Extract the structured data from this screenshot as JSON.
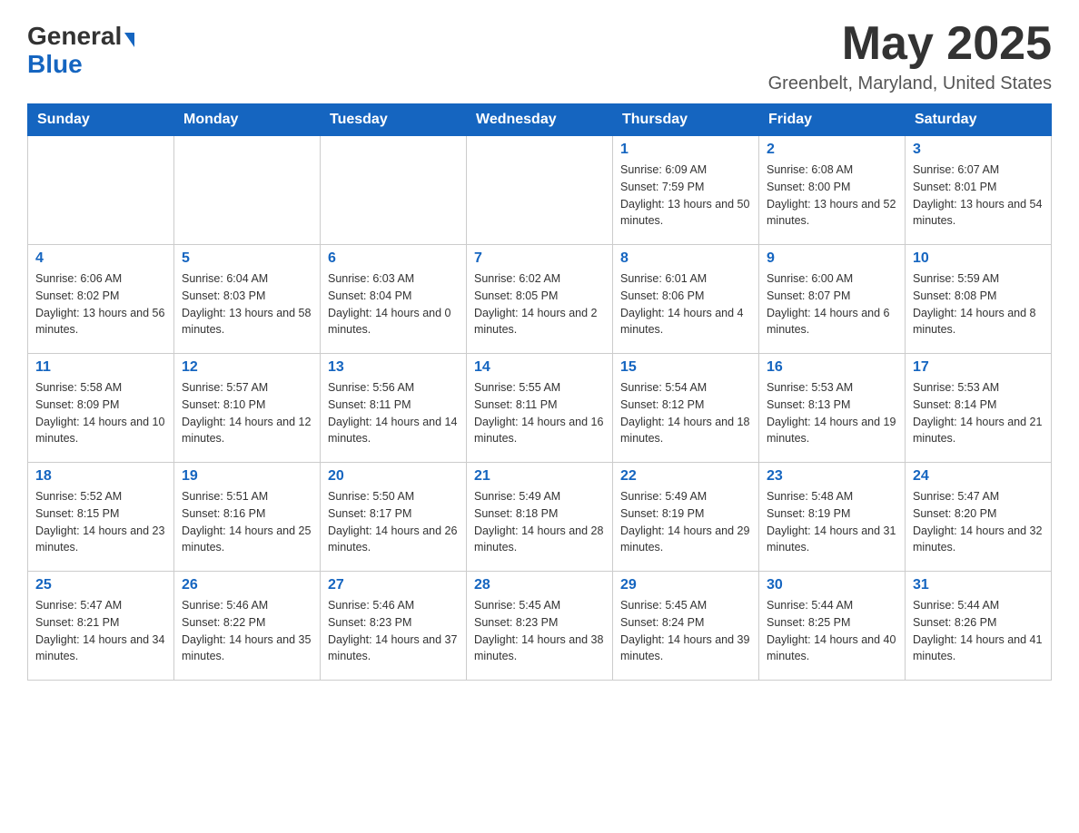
{
  "logo": {
    "general": "General",
    "blue": "Blue",
    "arrow": "▶"
  },
  "title": {
    "month_year": "May 2025",
    "location": "Greenbelt, Maryland, United States"
  },
  "weekdays": [
    "Sunday",
    "Monday",
    "Tuesday",
    "Wednesday",
    "Thursday",
    "Friday",
    "Saturday"
  ],
  "weeks": [
    [
      {
        "day": "",
        "info": ""
      },
      {
        "day": "",
        "info": ""
      },
      {
        "day": "",
        "info": ""
      },
      {
        "day": "",
        "info": ""
      },
      {
        "day": "1",
        "info": "Sunrise: 6:09 AM\nSunset: 7:59 PM\nDaylight: 13 hours and 50 minutes."
      },
      {
        "day": "2",
        "info": "Sunrise: 6:08 AM\nSunset: 8:00 PM\nDaylight: 13 hours and 52 minutes."
      },
      {
        "day": "3",
        "info": "Sunrise: 6:07 AM\nSunset: 8:01 PM\nDaylight: 13 hours and 54 minutes."
      }
    ],
    [
      {
        "day": "4",
        "info": "Sunrise: 6:06 AM\nSunset: 8:02 PM\nDaylight: 13 hours and 56 minutes."
      },
      {
        "day": "5",
        "info": "Sunrise: 6:04 AM\nSunset: 8:03 PM\nDaylight: 13 hours and 58 minutes."
      },
      {
        "day": "6",
        "info": "Sunrise: 6:03 AM\nSunset: 8:04 PM\nDaylight: 14 hours and 0 minutes."
      },
      {
        "day": "7",
        "info": "Sunrise: 6:02 AM\nSunset: 8:05 PM\nDaylight: 14 hours and 2 minutes."
      },
      {
        "day": "8",
        "info": "Sunrise: 6:01 AM\nSunset: 8:06 PM\nDaylight: 14 hours and 4 minutes."
      },
      {
        "day": "9",
        "info": "Sunrise: 6:00 AM\nSunset: 8:07 PM\nDaylight: 14 hours and 6 minutes."
      },
      {
        "day": "10",
        "info": "Sunrise: 5:59 AM\nSunset: 8:08 PM\nDaylight: 14 hours and 8 minutes."
      }
    ],
    [
      {
        "day": "11",
        "info": "Sunrise: 5:58 AM\nSunset: 8:09 PM\nDaylight: 14 hours and 10 minutes."
      },
      {
        "day": "12",
        "info": "Sunrise: 5:57 AM\nSunset: 8:10 PM\nDaylight: 14 hours and 12 minutes."
      },
      {
        "day": "13",
        "info": "Sunrise: 5:56 AM\nSunset: 8:11 PM\nDaylight: 14 hours and 14 minutes."
      },
      {
        "day": "14",
        "info": "Sunrise: 5:55 AM\nSunset: 8:11 PM\nDaylight: 14 hours and 16 minutes."
      },
      {
        "day": "15",
        "info": "Sunrise: 5:54 AM\nSunset: 8:12 PM\nDaylight: 14 hours and 18 minutes."
      },
      {
        "day": "16",
        "info": "Sunrise: 5:53 AM\nSunset: 8:13 PM\nDaylight: 14 hours and 19 minutes."
      },
      {
        "day": "17",
        "info": "Sunrise: 5:53 AM\nSunset: 8:14 PM\nDaylight: 14 hours and 21 minutes."
      }
    ],
    [
      {
        "day": "18",
        "info": "Sunrise: 5:52 AM\nSunset: 8:15 PM\nDaylight: 14 hours and 23 minutes."
      },
      {
        "day": "19",
        "info": "Sunrise: 5:51 AM\nSunset: 8:16 PM\nDaylight: 14 hours and 25 minutes."
      },
      {
        "day": "20",
        "info": "Sunrise: 5:50 AM\nSunset: 8:17 PM\nDaylight: 14 hours and 26 minutes."
      },
      {
        "day": "21",
        "info": "Sunrise: 5:49 AM\nSunset: 8:18 PM\nDaylight: 14 hours and 28 minutes."
      },
      {
        "day": "22",
        "info": "Sunrise: 5:49 AM\nSunset: 8:19 PM\nDaylight: 14 hours and 29 minutes."
      },
      {
        "day": "23",
        "info": "Sunrise: 5:48 AM\nSunset: 8:19 PM\nDaylight: 14 hours and 31 minutes."
      },
      {
        "day": "24",
        "info": "Sunrise: 5:47 AM\nSunset: 8:20 PM\nDaylight: 14 hours and 32 minutes."
      }
    ],
    [
      {
        "day": "25",
        "info": "Sunrise: 5:47 AM\nSunset: 8:21 PM\nDaylight: 14 hours and 34 minutes."
      },
      {
        "day": "26",
        "info": "Sunrise: 5:46 AM\nSunset: 8:22 PM\nDaylight: 14 hours and 35 minutes."
      },
      {
        "day": "27",
        "info": "Sunrise: 5:46 AM\nSunset: 8:23 PM\nDaylight: 14 hours and 37 minutes."
      },
      {
        "day": "28",
        "info": "Sunrise: 5:45 AM\nSunset: 8:23 PM\nDaylight: 14 hours and 38 minutes."
      },
      {
        "day": "29",
        "info": "Sunrise: 5:45 AM\nSunset: 8:24 PM\nDaylight: 14 hours and 39 minutes."
      },
      {
        "day": "30",
        "info": "Sunrise: 5:44 AM\nSunset: 8:25 PM\nDaylight: 14 hours and 40 minutes."
      },
      {
        "day": "31",
        "info": "Sunrise: 5:44 AM\nSunset: 8:26 PM\nDaylight: 14 hours and 41 minutes."
      }
    ]
  ]
}
